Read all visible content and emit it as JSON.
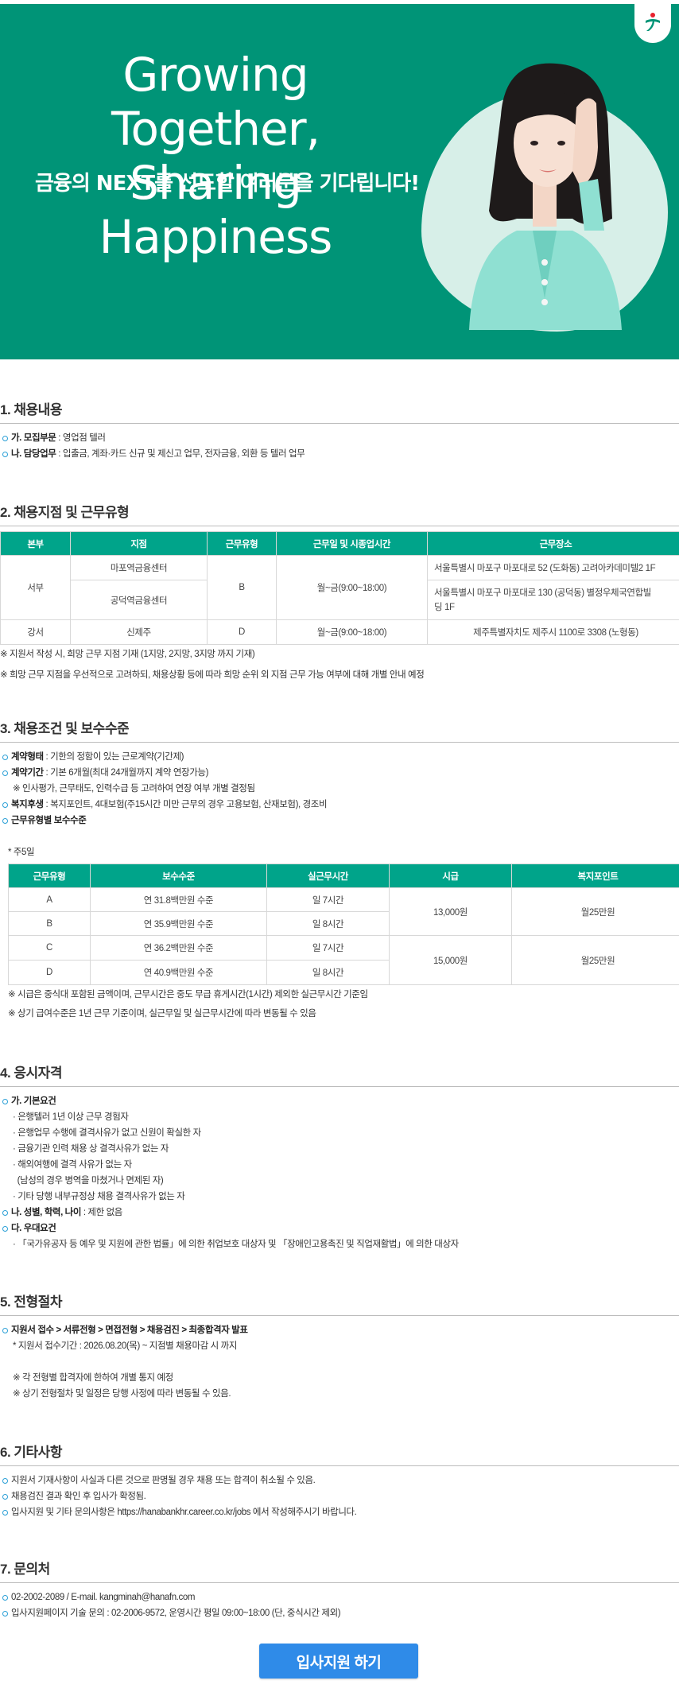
{
  "banner": {
    "title_line1": "Growing Together,",
    "title_line2": "Sharing Happiness",
    "subtitle": "금융의 NEXT를 선도할 여러분을 기다립니다!",
    "bg_color": "#009477"
  },
  "s1": {
    "title": "1. 채용내용",
    "items": [
      {
        "label": "가. 모집부문",
        "text": " : 영업점 텔러"
      },
      {
        "label": "나. 담당업무",
        "text": " : 입출금, 계좌·카드 신규 및 제신고 업무, 전자금융, 외환 등 텔러 업무"
      }
    ]
  },
  "s2": {
    "title": "2. 채용지점 및 근무유형",
    "headers": [
      "본부",
      "지점",
      "근무유형",
      "근무일 및 시종업시간",
      "근무장소"
    ],
    "rows": [
      {
        "region": "서부",
        "branch": "마포역금융센터",
        "type": "B",
        "hours": "월~금(9:00~18:00)",
        "place": "서울특별시 마포구 마포대로 52 (도화동) 고려아카데미텔2 1F"
      },
      {
        "branch": "공덕역금융센터",
        "place_line1": "서울특별시 마포구 마포대로 130 (공덕동) 별정우체국연합빌",
        "place_line2": "딩 1F"
      },
      {
        "region": "강서",
        "branch": "신제주",
        "type": "D",
        "hours": "월~금(9:00~18:00)",
        "place": "제주특별자치도 제주시 1100로 3308 (노형동)"
      }
    ],
    "notes": [
      "※ 지원서 작성 시, 희망 근무 지점 기재 (1지망, 2지망, 3지망 까지 기재)",
      "※ 희망 근무 지점을 우선적으로 고려하되, 채용상황 등에 따라 희망 순위 외 지점 근무 가능 여부에 대해 개별 안내 예정"
    ]
  },
  "s3": {
    "title": "3. 채용조건 및 보수수준",
    "items": [
      {
        "label": "계약형태",
        "text": " : 기한의 정함이 있는 근로계약(기간제)"
      },
      {
        "label": "계약기간",
        "text": " : 기본 6개월(최대 24개월까지 계약 연장가능)"
      },
      {
        "sub": "※ 인사평가, 근무태도, 인력수급 등 고려하여 연장 여부 개별 결정됨"
      },
      {
        "label": "복지후생",
        "text": " : 복지포인트, 4대보험(주15시간 미만 근무의 경우 고용보험, 산재보험), 경조비"
      },
      {
        "label": "근무유형별 보수수준",
        "text": ""
      }
    ],
    "week_note": "* 주5일",
    "headers": [
      "근무유형",
      "보수수준",
      "실근무시간",
      "시급",
      "복지포인트"
    ],
    "rows": [
      {
        "type": "A",
        "pay": "연 31.8백만원 수준",
        "hours": "일 7시간"
      },
      {
        "type": "B",
        "pay": "연 35.9백만원 수준",
        "hours": "일 8시간"
      },
      {
        "type": "C",
        "pay": "연 36.2백만원 수준",
        "hours": "일 7시간"
      },
      {
        "type": "D",
        "pay": "연 40.9백만원 수준",
        "hours": "일 8시간"
      }
    ],
    "wage_ab": "13,000원",
    "wage_cd": "15,000원",
    "point_ab": "월25만원",
    "point_cd": "월25만원",
    "notes": [
      "※ 시급은 중식대 포함된 금액이며, 근무시간은 중도 무급 휴게시간(1시간) 제외한 실근무시간 기준임",
      "※ 상기 급여수준은 1년 근무 기준이며, 실근무일 및 실근무시간에 따라 변동될 수 있음"
    ]
  },
  "s4": {
    "title": "4. 응시자격",
    "basic_label": "가. 기본요건",
    "basic": [
      "· 은행텔러 1년 이상 근무 경험자",
      "· 은행업무 수행에 결격사유가 없고 신원이 확실한 자",
      "· 금융기관 인력 채용 상 결격사유가 없는 자",
      "· 해외여행에 결격 사유가 없는 자",
      "  (남성의 경우 병역을 마쳤거나 면제된 자)",
      "· 기타 당행 내부규정상 채용 결격사유가 없는 자"
    ],
    "gender_label": "나. 성별, 학력, 나이",
    "gender_text": " : 제한 없음",
    "pref_label": "다. 우대요건",
    "pref_text": "· 「국가유공자 등 예우 및 지원에 관한 법률」에 의한 취업보호 대상자 및 「장애인고용촉진 및 직업재활법」에 의한 대상자"
  },
  "s5": {
    "title": "5. 전형절차",
    "steps": "지원서 접수 > 서류전형 > 면접전형 > 채용검진 > 최종합격자 발표",
    "period": "* 지원서 접수기간 : 2026.08.20(목) ~ 지점별 채용마감 시 까지",
    "notes": [
      "※ 각 전형별 합격자에 한하여 개별 통지 예정",
      "※ 상기 전형절차 및 일정은 당행 사정에 따라 변동될 수 있음."
    ]
  },
  "s6": {
    "title": "6. 기타사항",
    "items": [
      "지원서 기재사항이 사실과 다른 것으로 판명될 경우 채용 또는 합격이 취소될 수 있음.",
      "채용검진 결과 확인 후 입사가 확정됨.",
      "입사지원 및 기타 문의사항은 https://hanabankhr.career.co.kr/jobs 에서 작성해주시기 바랍니다."
    ]
  },
  "s7": {
    "title": "7. 문의처",
    "items": [
      "02-2002-2089 / E-mail. kangminah@hanafn.com",
      "입사지원페이지 기술 문의 : 02-2006-9572, 운영시간 평일 09:00~18:00 (단, 중식시간 제외)"
    ]
  },
  "apply_button": "입사지원 하기",
  "colors": {
    "header_teal": "#00a48a",
    "button_blue": "#2f8be8",
    "bullet_blue": "#2a9fd6"
  }
}
